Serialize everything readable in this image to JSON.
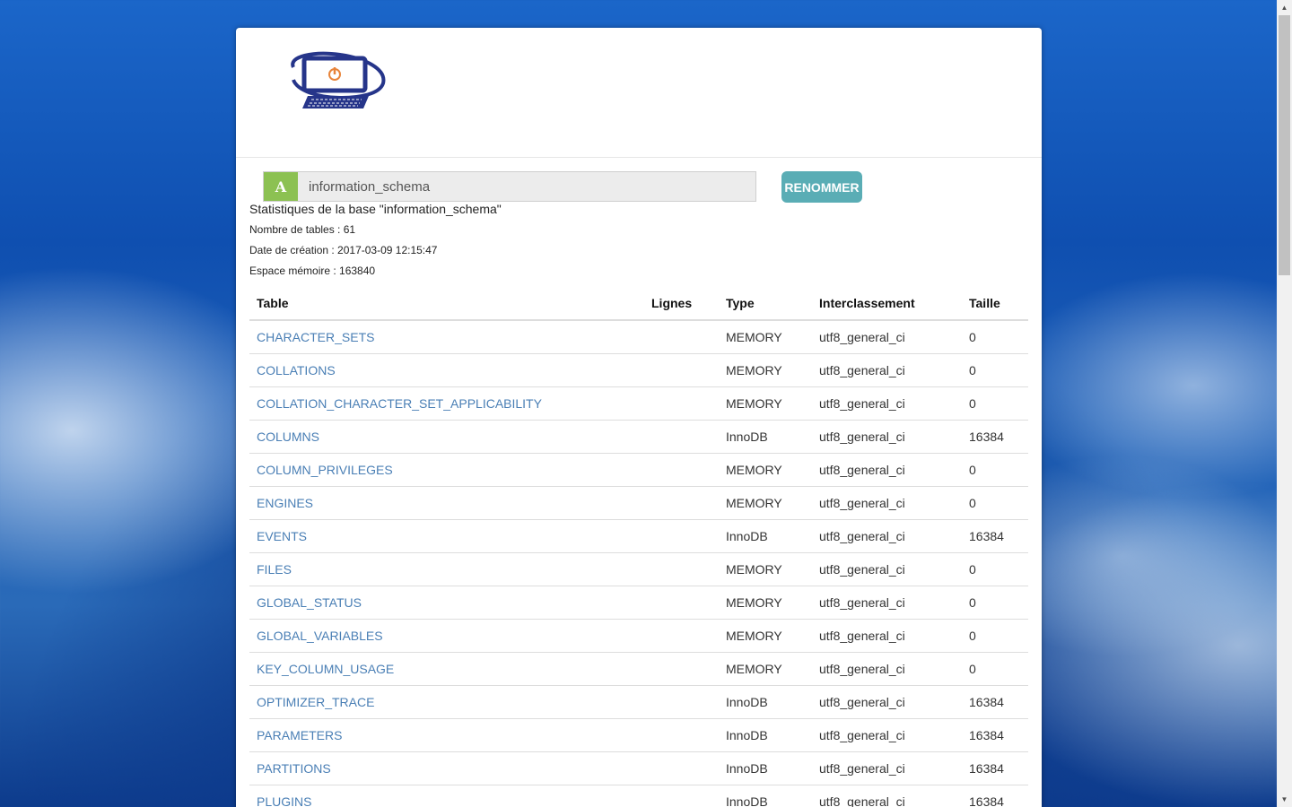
{
  "logo": {
    "icon": "power-monitor-logo",
    "colors": {
      "primary": "#26358a",
      "accent": "#e8843a"
    }
  },
  "rename": {
    "addon_label": "A",
    "db_value": "information_schema",
    "button_label": "RENOMMER"
  },
  "stats": {
    "title": "Statistiques de la base \"information_schema\"",
    "tables_count": "Nombre de tables : 61",
    "creation_date": "Date de création : 2017-03-09 12:15:47",
    "memory": "Espace mémoire : 163840"
  },
  "table": {
    "headers": {
      "table": "Table",
      "lignes": "Lignes",
      "type": "Type",
      "interclassement": "Interclassement",
      "taille": "Taille"
    },
    "rows": [
      {
        "name": "CHARACTER_SETS",
        "lignes": "",
        "type": "MEMORY",
        "collation": "utf8_general_ci",
        "size": "0"
      },
      {
        "name": "COLLATIONS",
        "lignes": "",
        "type": "MEMORY",
        "collation": "utf8_general_ci",
        "size": "0"
      },
      {
        "name": "COLLATION_CHARACTER_SET_APPLICABILITY",
        "lignes": "",
        "type": "MEMORY",
        "collation": "utf8_general_ci",
        "size": "0"
      },
      {
        "name": "COLUMNS",
        "lignes": "",
        "type": "InnoDB",
        "collation": "utf8_general_ci",
        "size": "16384"
      },
      {
        "name": "COLUMN_PRIVILEGES",
        "lignes": "",
        "type": "MEMORY",
        "collation": "utf8_general_ci",
        "size": "0"
      },
      {
        "name": "ENGINES",
        "lignes": "",
        "type": "MEMORY",
        "collation": "utf8_general_ci",
        "size": "0"
      },
      {
        "name": "EVENTS",
        "lignes": "",
        "type": "InnoDB",
        "collation": "utf8_general_ci",
        "size": "16384"
      },
      {
        "name": "FILES",
        "lignes": "",
        "type": "MEMORY",
        "collation": "utf8_general_ci",
        "size": "0"
      },
      {
        "name": "GLOBAL_STATUS",
        "lignes": "",
        "type": "MEMORY",
        "collation": "utf8_general_ci",
        "size": "0"
      },
      {
        "name": "GLOBAL_VARIABLES",
        "lignes": "",
        "type": "MEMORY",
        "collation": "utf8_general_ci",
        "size": "0"
      },
      {
        "name": "KEY_COLUMN_USAGE",
        "lignes": "",
        "type": "MEMORY",
        "collation": "utf8_general_ci",
        "size": "0"
      },
      {
        "name": "OPTIMIZER_TRACE",
        "lignes": "",
        "type": "InnoDB",
        "collation": "utf8_general_ci",
        "size": "16384"
      },
      {
        "name": "PARAMETERS",
        "lignes": "",
        "type": "InnoDB",
        "collation": "utf8_general_ci",
        "size": "16384"
      },
      {
        "name": "PARTITIONS",
        "lignes": "",
        "type": "InnoDB",
        "collation": "utf8_general_ci",
        "size": "16384"
      },
      {
        "name": "PLUGINS",
        "lignes": "",
        "type": "InnoDB",
        "collation": "utf8_general_ci",
        "size": "16384"
      }
    ]
  },
  "colors": {
    "link": "#4a7fb5",
    "button": "#5aadb5",
    "addon": "#8cc152"
  }
}
